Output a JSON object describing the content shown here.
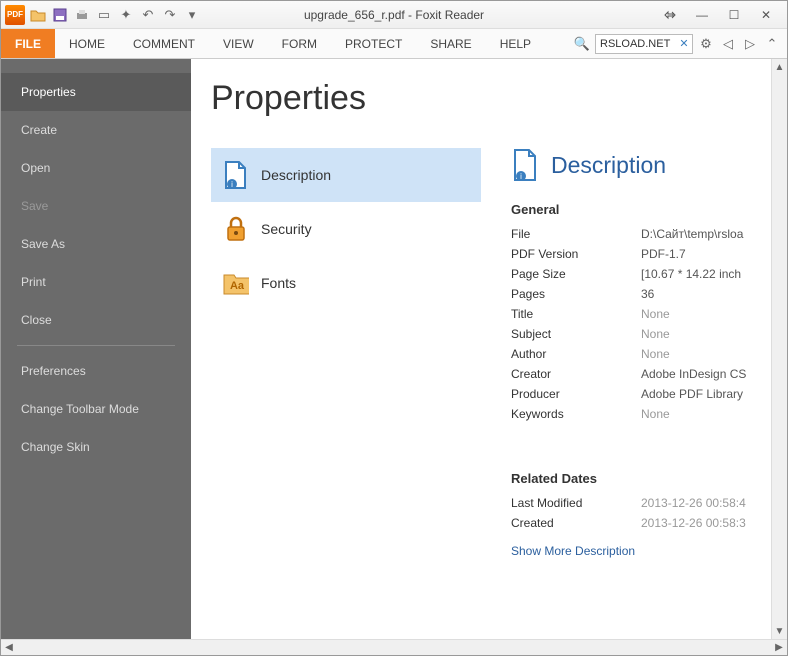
{
  "titlebar": {
    "title": "upgrade_656_r.pdf - Foxit Reader",
    "logo_text": "PDF"
  },
  "ribbon": {
    "tabs": [
      "FILE",
      "HOME",
      "COMMENT",
      "VIEW",
      "FORM",
      "PROTECT",
      "SHARE",
      "HELP"
    ],
    "active_index": 0,
    "search_value": "RSLOAD.NET"
  },
  "sidebar": {
    "items": [
      {
        "label": "Properties",
        "state": "selected"
      },
      {
        "label": "Create",
        "state": ""
      },
      {
        "label": "Open",
        "state": ""
      },
      {
        "label": "Save",
        "state": "disabled"
      },
      {
        "label": "Save As",
        "state": ""
      },
      {
        "label": "Print",
        "state": ""
      },
      {
        "label": "Close",
        "state": ""
      }
    ],
    "items2": [
      {
        "label": "Preferences"
      },
      {
        "label": "Change Toolbar Mode"
      },
      {
        "label": "Change Skin"
      }
    ]
  },
  "page": {
    "title": "Properties",
    "nav": [
      {
        "label": "Description",
        "selected": true
      },
      {
        "label": "Security",
        "selected": false
      },
      {
        "label": "Fonts",
        "selected": false
      }
    ],
    "details_title": "Description",
    "general_heading": "General",
    "general": [
      {
        "k": "File",
        "v": "D:\\Сайт\\temp\\rsloa",
        "none": false
      },
      {
        "k": "PDF Version",
        "v": "PDF-1.7",
        "none": false
      },
      {
        "k": "Page Size",
        "v": "[10.67 * 14.22 inch",
        "none": false
      },
      {
        "k": "Pages",
        "v": "36",
        "none": false
      },
      {
        "k": "Title",
        "v": "None",
        "none": true
      },
      {
        "k": "Subject",
        "v": "None",
        "none": true
      },
      {
        "k": "Author",
        "v": "None",
        "none": true
      },
      {
        "k": "Creator",
        "v": "Adobe InDesign CS",
        "none": false
      },
      {
        "k": "Producer",
        "v": "Adobe PDF Library",
        "none": false
      },
      {
        "k": "Keywords",
        "v": "None",
        "none": true
      }
    ],
    "related_heading": "Related Dates",
    "related": [
      {
        "k": "Last Modified",
        "v": "2013-12-26 00:58:4"
      },
      {
        "k": "Created",
        "v": "2013-12-26 00:58:3"
      }
    ],
    "more_link": "Show More Description"
  }
}
